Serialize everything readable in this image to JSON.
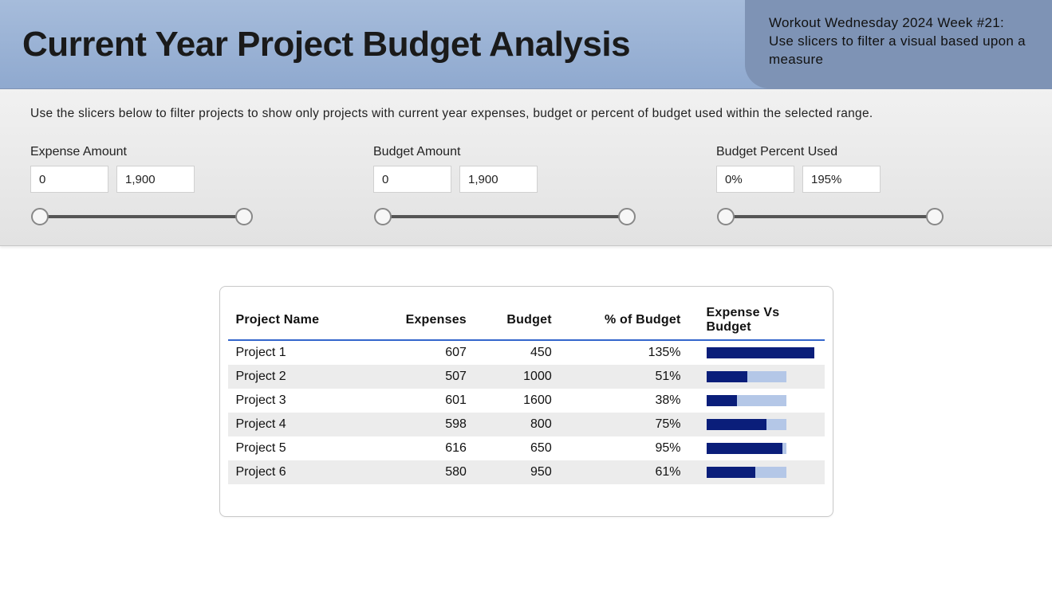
{
  "header": {
    "title": "Current Year Project Budget Analysis",
    "subtitle": "Workout Wednesday 2024 Week #21: Use slicers to filter a visual based upon a measure"
  },
  "instructions": "Use the slicers below to filter projects to show only projects with current year expenses, budget or percent of budget used within the selected range.",
  "slicers": {
    "expense": {
      "label": "Expense Amount",
      "min": "0",
      "max": "1,900"
    },
    "budget": {
      "label": "Budget Amount",
      "min": "0",
      "max": "1,900"
    },
    "percent": {
      "label": "Budget Percent Used",
      "min": "0%",
      "max": "195%"
    }
  },
  "table": {
    "headers": {
      "name": "Project Name",
      "expenses": "Expenses",
      "budget": "Budget",
      "pct": "% of Budget",
      "bar": "Expense Vs Budget"
    }
  },
  "chart_data": {
    "type": "table",
    "title": "Current Year Project Budget Analysis",
    "columns": [
      "Project Name",
      "Expenses",
      "Budget",
      "% of Budget"
    ],
    "rows": [
      {
        "name": "Project 1",
        "expenses": 607,
        "budget": 450,
        "pct": 135,
        "pct_label": "135%"
      },
      {
        "name": "Project 2",
        "expenses": 507,
        "budget": 1000,
        "pct": 51,
        "pct_label": "51%"
      },
      {
        "name": "Project 3",
        "expenses": 601,
        "budget": 1600,
        "pct": 38,
        "pct_label": "38%"
      },
      {
        "name": "Project 4",
        "expenses": 598,
        "budget": 800,
        "pct": 75,
        "pct_label": "75%"
      },
      {
        "name": "Project 5",
        "expenses": 616,
        "budget": 650,
        "pct": 95,
        "pct_label": "95%"
      },
      {
        "name": "Project 6",
        "expenses": 580,
        "budget": 950,
        "pct": 61,
        "pct_label": "61%"
      }
    ],
    "bar_max_pct": 135
  }
}
